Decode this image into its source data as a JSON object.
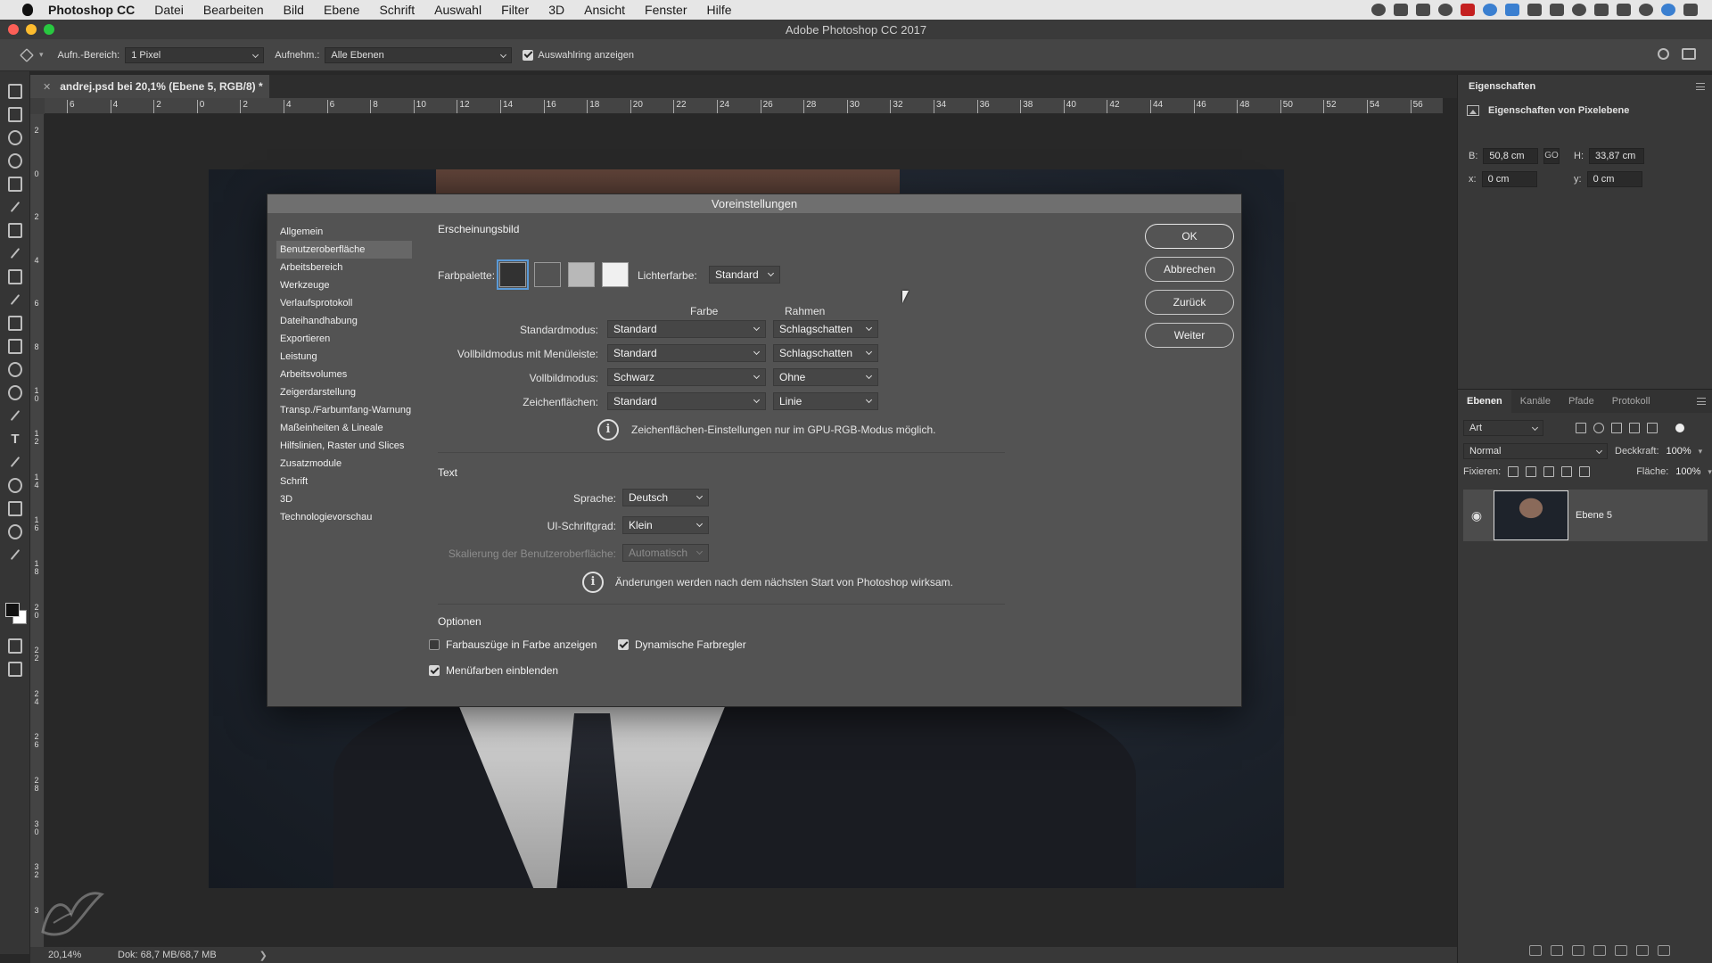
{
  "menubar": {
    "app": "Photoshop CC",
    "items": [
      "Datei",
      "Bearbeiten",
      "Bild",
      "Ebene",
      "Schrift",
      "Auswahl",
      "Filter",
      "3D",
      "Ansicht",
      "Fenster",
      "Hilfe"
    ]
  },
  "window": {
    "title": "Adobe Photoshop CC 2017"
  },
  "options": {
    "sample_size_label": "Aufn.-Bereich:",
    "sample_size_value": "1 Pixel",
    "sample_label": "Aufnehm.:",
    "sample_value": "Alle Ebenen",
    "show_ring_label": "Auswahlring anzeigen",
    "show_ring_checked": true
  },
  "document": {
    "tab_title": "andrej.psd bei 20,1% (Ebene 5, RGB/8) *",
    "ruler_h": [
      "6",
      "4",
      "2",
      "0",
      "2",
      "4",
      "6",
      "8",
      "10",
      "12",
      "14",
      "16",
      "18",
      "20",
      "22",
      "24",
      "26",
      "28",
      "30",
      "32",
      "34",
      "36",
      "38",
      "40",
      "42",
      "44",
      "46",
      "48",
      "50",
      "52",
      "54",
      "56"
    ],
    "ruler_v": [
      "2",
      "0",
      "2",
      "4",
      "6",
      "8",
      "1\n0",
      "1\n2",
      "1\n4",
      "1\n6",
      "1\n8",
      "2\n0",
      "2\n2",
      "2\n4",
      "2\n6",
      "2\n8",
      "3\n0",
      "3\n2",
      "3"
    ]
  },
  "status": {
    "zoom": "20,14%",
    "doc": "Dok: 68,7 MB/68,7 MB",
    "arrow": "❯"
  },
  "properties": {
    "title": "Eigenschaften",
    "subtitle": "Eigenschaften von Pixelebene",
    "w_label": "B:",
    "w_value": "50,8 cm",
    "h_label": "H:",
    "h_value": "33,87 cm",
    "x_label": "x:",
    "x_value": "0 cm",
    "y_label": "y:",
    "y_value": "0 cm",
    "link": "GO"
  },
  "layers": {
    "tabs": [
      "Ebenen",
      "Kanäle",
      "Pfade",
      "Protokoll"
    ],
    "filter": "Art",
    "blend": "Normal",
    "opacity_label": "Deckkraft:",
    "opacity_value": "100%",
    "lock_label": "Fixieren:",
    "fill_label": "Fläche:",
    "fill_value": "100%",
    "layer_name": "Ebene 5",
    "eye": "◉"
  },
  "dialog": {
    "title": "Voreinstellungen",
    "nav": [
      "Allgemein",
      "Benutzeroberfläche",
      "Arbeitsbereich",
      "Werkzeuge",
      "Verlaufsprotokoll",
      "Dateihandhabung",
      "Exportieren",
      "Leistung",
      "Arbeitsvolumes",
      "Zeigerdarstellung",
      "Transp./Farbumfang-Warnung",
      "Maßeinheiten & Lineale",
      "Hilfslinien, Raster und Slices",
      "Zusatzmodule",
      "Schrift",
      "3D",
      "Technologievorschau"
    ],
    "nav_selected": "Benutzeroberfläche",
    "appearance": {
      "title": "Erscheinungsbild",
      "palette_label": "Farbpalette:",
      "palette_colors": [
        "#323232",
        "#535353",
        "#b8b8b8",
        "#f0f0f0"
      ],
      "highlight_label": "Lichterfarbe:",
      "highlight_value": "Standard",
      "col_color": "Farbe",
      "col_border": "Rahmen",
      "rows": [
        {
          "label": "Standardmodus:",
          "color": "Standard",
          "border": "Schlagschatten"
        },
        {
          "label": "Vollbildmodus mit Menüleiste:",
          "color": "Standard",
          "border": "Schlagschatten"
        },
        {
          "label": "Vollbildmodus:",
          "color": "Schwarz",
          "border": "Ohne"
        },
        {
          "label": "Zeichenflächen:",
          "color": "Standard",
          "border": "Linie"
        }
      ],
      "info": "Zeichenflächen-Einstellungen nur im GPU-RGB-Modus möglich."
    },
    "text": {
      "title": "Text",
      "lang_label": "Sprache:",
      "lang_value": "Deutsch",
      "size_label": "UI-Schriftgrad:",
      "size_value": "Klein",
      "scale_label": "Skalierung der Benutzeroberfläche:",
      "scale_value": "Automatisch",
      "info": "Änderungen werden nach dem nächsten Start von Photoshop wirksam."
    },
    "options": {
      "title": "Optionen",
      "items": [
        {
          "label": "Farbauszüge in Farbe anzeigen",
          "checked": false
        },
        {
          "label": "Dynamische Farbregler",
          "checked": true
        },
        {
          "label": "Menüfarben einblenden",
          "checked": true
        }
      ]
    },
    "buttons": [
      "OK",
      "Abbrechen",
      "Zurück",
      "Weiter"
    ],
    "info_glyph": "i"
  }
}
